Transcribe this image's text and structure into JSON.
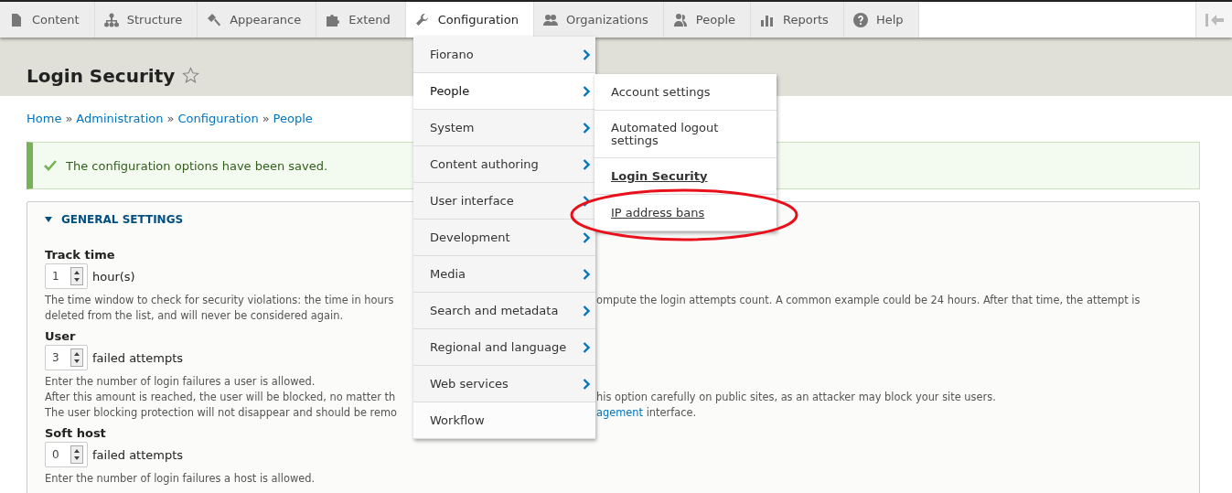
{
  "toolbar": {
    "items": [
      {
        "label": "Content",
        "active": false
      },
      {
        "label": "Structure",
        "active": false
      },
      {
        "label": "Appearance",
        "active": false
      },
      {
        "label": "Extend",
        "active": false
      },
      {
        "label": "Configuration",
        "active": true
      },
      {
        "label": "Organizations",
        "active": false
      },
      {
        "label": "People",
        "active": false
      },
      {
        "label": "Reports",
        "active": false
      },
      {
        "label": "Help",
        "active": false
      }
    ]
  },
  "page": {
    "title": "Login Security",
    "breadcrumb": [
      "Home",
      "Administration",
      "Configuration",
      "People"
    ],
    "breadcrumb_separator": "»"
  },
  "message": {
    "text": "The configuration options have been saved."
  },
  "fieldset": {
    "legend": "GENERAL SETTINGS",
    "expanded": true,
    "fields": [
      {
        "label": "Track time",
        "value": "1",
        "suffix": "hour(s)",
        "description": [
          {
            "left": "The time window to check for security violations: the time in hours",
            "right": [
              {
                "kind": "text",
                "text": "ompute the login attempts count. A common example could be 24 hours. After that time, the attempt is"
              }
            ]
          },
          {
            "left": "deleted from the list, and will never be considered again."
          }
        ]
      },
      {
        "label": "User",
        "value": "3",
        "suffix": "failed attempts",
        "description": [
          {
            "left": "Enter the number of login failures a user is allowed."
          },
          {
            "left": "After this amount is reached, the user will be blocked, no matter th",
            "right": [
              {
                "kind": "text",
                "text": "his option carefully on public sites, as an attacker may block your site users."
              }
            ]
          },
          {
            "left": "The user blocking protection will not disappear and should be remo",
            "right": [
              {
                "kind": "link",
                "text": "agement"
              },
              {
                "kind": "text",
                "text": " interface."
              }
            ]
          }
        ]
      },
      {
        "label": "Soft host",
        "value": "0",
        "suffix": "failed attempts",
        "description": [
          {
            "left": "Enter the number of login failures a host is allowed."
          }
        ]
      }
    ]
  },
  "menu": {
    "items": [
      {
        "label": "Fiorano",
        "has_children": true,
        "selected": false
      },
      {
        "label": "People",
        "has_children": true,
        "selected": true
      },
      {
        "label": "System",
        "has_children": true,
        "selected": false
      },
      {
        "label": "Content authoring",
        "has_children": true,
        "selected": false
      },
      {
        "label": "User interface",
        "has_children": true,
        "selected": false
      },
      {
        "label": "Development",
        "has_children": true,
        "selected": false
      },
      {
        "label": "Media",
        "has_children": true,
        "selected": false
      },
      {
        "label": "Search and metadata",
        "has_children": true,
        "selected": false
      },
      {
        "label": "Regional and language",
        "has_children": true,
        "selected": false
      },
      {
        "label": "Web services",
        "has_children": true,
        "selected": false
      },
      {
        "label": "Workflow",
        "has_children": false,
        "selected": false
      }
    ],
    "submenu": [
      {
        "label": "Account settings",
        "active": false,
        "underlined": false
      },
      {
        "label": "Automated logout settings",
        "active": false,
        "underlined": false
      },
      {
        "label": "Login Security",
        "active": true,
        "underlined": true
      },
      {
        "label": "IP address bans",
        "active": false,
        "underlined": true,
        "circled": true
      }
    ]
  }
}
